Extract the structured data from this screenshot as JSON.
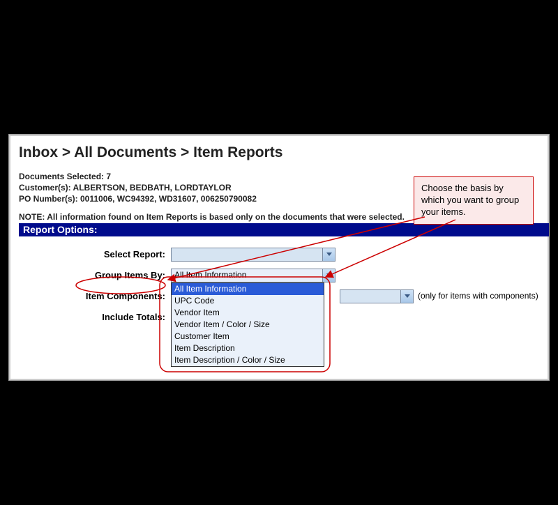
{
  "breadcrumb": "Inbox > All Documents > Item Reports",
  "meta": {
    "docs_selected": "Documents Selected: 7",
    "customers": "Customer(s): ALBERTSON, BEDBATH, LORDTAYLOR",
    "po_numbers": "PO Number(s): 0011006, WC94392, WD31607, 006250790082"
  },
  "note": "NOTE: All information found on Item Reports is based only on the documents that were selected.",
  "section_title": "Report Options:",
  "form": {
    "select_report": {
      "label": "Select Report:"
    },
    "group_items_by": {
      "label": "Group Items By:",
      "selected": "All Item Information",
      "options": [
        "All Item Information",
        "UPC Code",
        "Vendor Item",
        "Vendor Item / Color / Size",
        "Customer Item",
        "Item Description",
        "Item Description / Color / Size"
      ]
    },
    "item_components": {
      "label": "Item Components:",
      "side_note": "(only for items with components)"
    },
    "include_totals": {
      "label": "Include Totals:"
    }
  },
  "callout": "Choose the basis by which you want to group your items."
}
